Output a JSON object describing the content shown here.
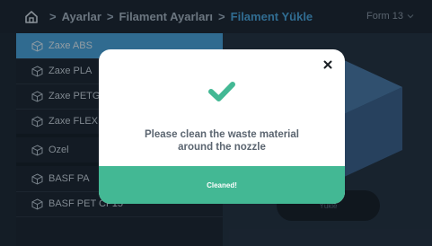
{
  "header": {
    "breadcrumb": [
      {
        "label": "Ayarlar"
      },
      {
        "label": "Filament Ayarları"
      },
      {
        "label": "Filament Yükle"
      }
    ],
    "separator": ">",
    "printer_name": "Form 13"
  },
  "sidebar": {
    "items": [
      {
        "label": "Zaxe ABS",
        "selected": true
      },
      {
        "label": "Zaxe PLA"
      },
      {
        "label": "Zaxe PETG"
      },
      {
        "label": "Zaxe FLEX"
      },
      {
        "label": "Ozel"
      },
      {
        "label": "BASF PA"
      },
      {
        "label": "BASF PET CF15"
      }
    ]
  },
  "main": {
    "load_button_label": "Yükle"
  },
  "modal": {
    "message_line1": "Please clean the waste material",
    "message_line2": "around the nozzle",
    "button_label": "Cleaned!",
    "close_symbol": "×"
  },
  "colors": {
    "accent": "#49a5de",
    "success": "#43b894",
    "background": "#1c2733"
  }
}
